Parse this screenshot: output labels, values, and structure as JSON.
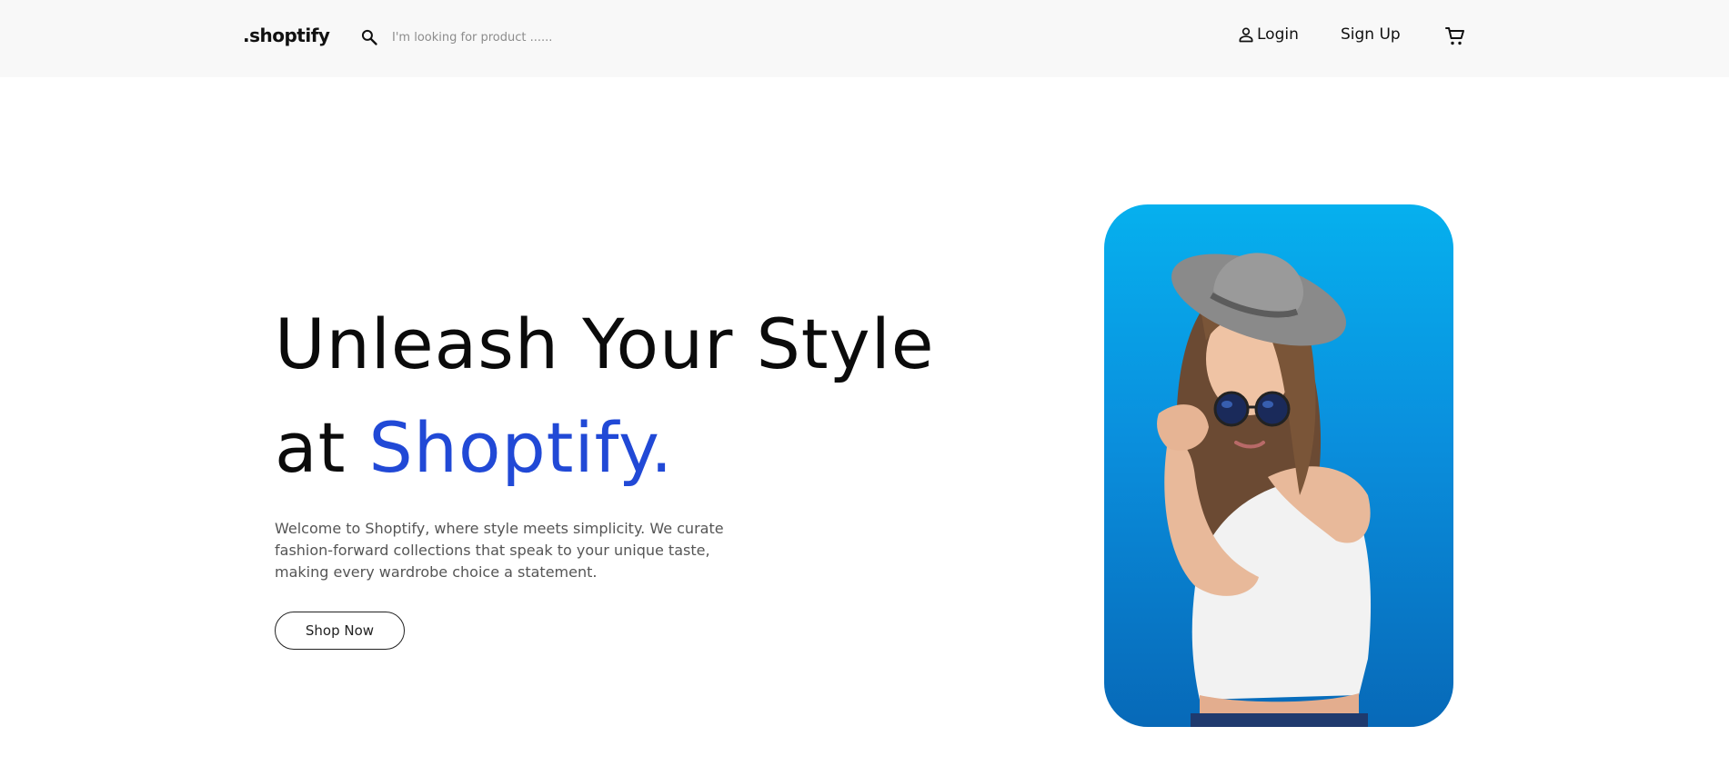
{
  "header": {
    "logo": ".shoptify",
    "search": {
      "placeholder": "I'm looking for product ......",
      "value": ""
    },
    "login_label": "Login",
    "signup_label": "Sign Up",
    "icons": {
      "search": "search-icon",
      "user": "user-icon",
      "cart": "cart-icon"
    }
  },
  "hero": {
    "title_line1": "Unleash Your Style",
    "title_line2_prefix": "at ",
    "title_line2_accent": "Shoptify.",
    "description": "Welcome to Shoptify, where style meets simplicity. We curate fashion-forward collections that speak to your unique taste, making every wardrobe choice a statement.",
    "cta_label": "Shop Now"
  },
  "colors": {
    "accent": "#2149d6",
    "header_bg": "#f8f8f8",
    "card_bg": "#0a8fdd"
  }
}
